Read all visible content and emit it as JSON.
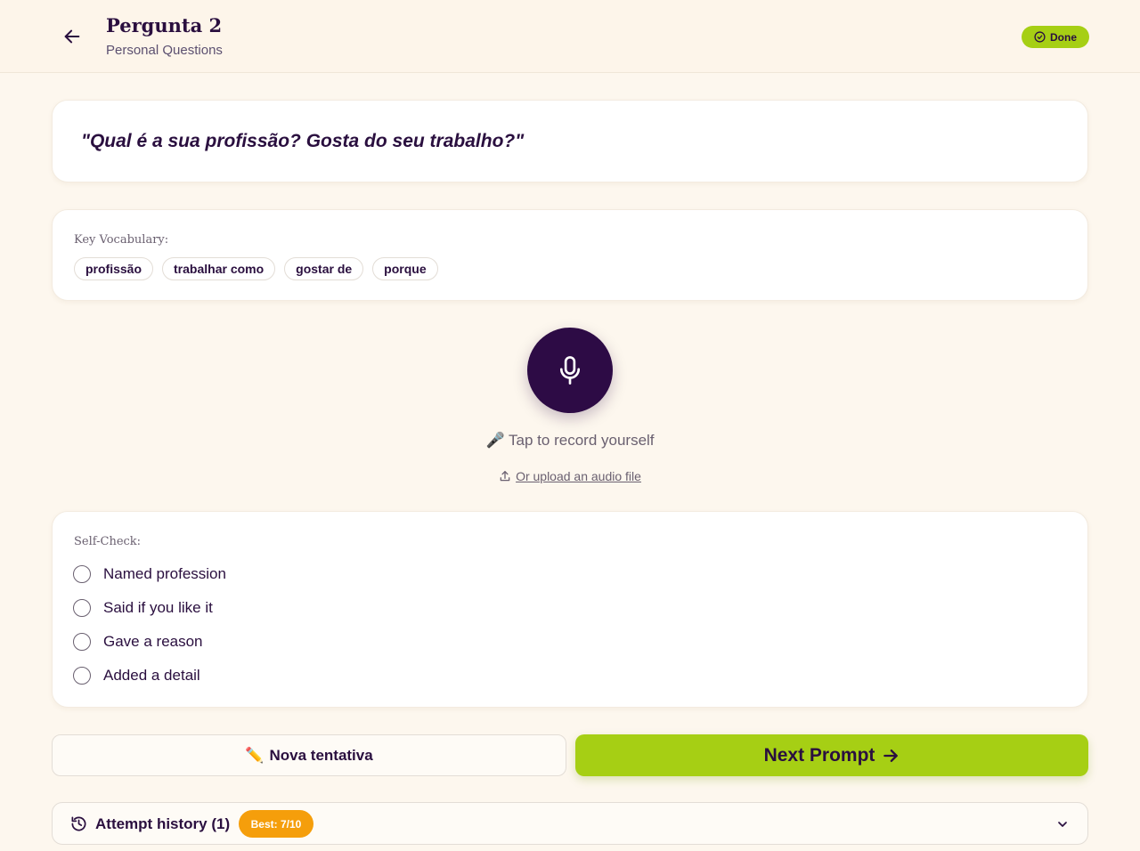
{
  "header": {
    "title": "Pergunta 2",
    "subtitle": "Personal Questions",
    "status_badge": "Done"
  },
  "question": {
    "text": "\"Qual é a sua profissão? Gosta do seu trabalho?\""
  },
  "vocabulary": {
    "label": "Key Vocabulary:",
    "chips": [
      "profissão",
      "trabalhar como",
      "gostar de",
      "porque"
    ]
  },
  "recorder": {
    "hint": "🎤 Tap to record yourself",
    "upload_label": "Or upload an audio file"
  },
  "self_check": {
    "label": "Self-Check:",
    "items": [
      "Named profession",
      "Said if you like it",
      "Gave a reason",
      "Added a detail"
    ]
  },
  "actions": {
    "retry_label": "Nova tentativa",
    "next_label": "Next Prompt"
  },
  "history": {
    "label": "Attempt history (1)",
    "best_badge": "Best: 7/10"
  },
  "colors": {
    "accent": "#a6cf14",
    "primary": "#2d0b45",
    "badge_orange": "#f59e0b",
    "background": "#fdf7ee"
  }
}
